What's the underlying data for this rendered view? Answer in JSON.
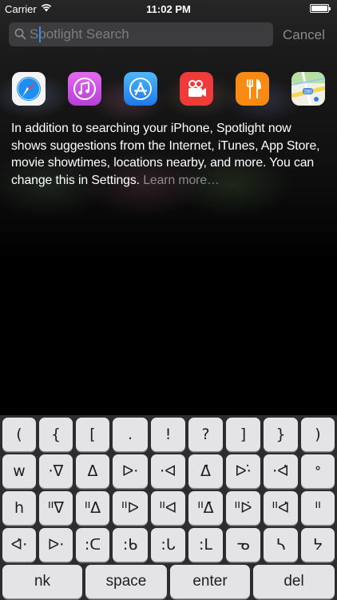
{
  "status_bar": {
    "carrier": "Carrier",
    "time": "11:02 PM"
  },
  "search": {
    "placeholder": "Spotlight Search",
    "cancel_label": "Cancel"
  },
  "apps": [
    {
      "name": "safari-icon"
    },
    {
      "name": "itunes-icon"
    },
    {
      "name": "app-store-icon"
    },
    {
      "name": "movies-icon"
    },
    {
      "name": "restaurants-icon"
    },
    {
      "name": "maps-icon"
    }
  ],
  "suggestion": {
    "text": "In addition to searching your iPhone, Spotlight now shows suggestions from the Internet, iTunes, App Store, movie showtimes, locations nearby, and more. You can change this in Settings. ",
    "learn_more": "Learn more…"
  },
  "keyboard": {
    "row1": [
      "(",
      "{",
      "[",
      ".",
      "!",
      "?",
      "]",
      "}",
      ")"
    ],
    "row2": [
      "w",
      "·ᐁ",
      "ᐃ",
      "ᐅ·",
      "·ᐊ",
      "ᐃ̇",
      "ᐅ·̇",
      "·ᐊ̇",
      "ᐤ"
    ],
    "row3": [
      "h",
      "ᐦᐁ",
      "ᐦᐃ",
      "ᐦᐅ",
      "ᐦᐊ",
      "ᐦᐃ̇",
      "ᐦᐅ̇",
      "ᐦᐊ̇",
      "ᐦ"
    ],
    "row4": [
      "ᐊ̇·",
      "ᐅ·",
      ":ᑕ",
      ":ᑲ",
      ":ᒐ",
      ":ᒪ",
      "ᓀ",
      "ᓴ",
      "ᔭ"
    ],
    "row5": [
      "nk",
      "space",
      "enter",
      "del"
    ]
  }
}
